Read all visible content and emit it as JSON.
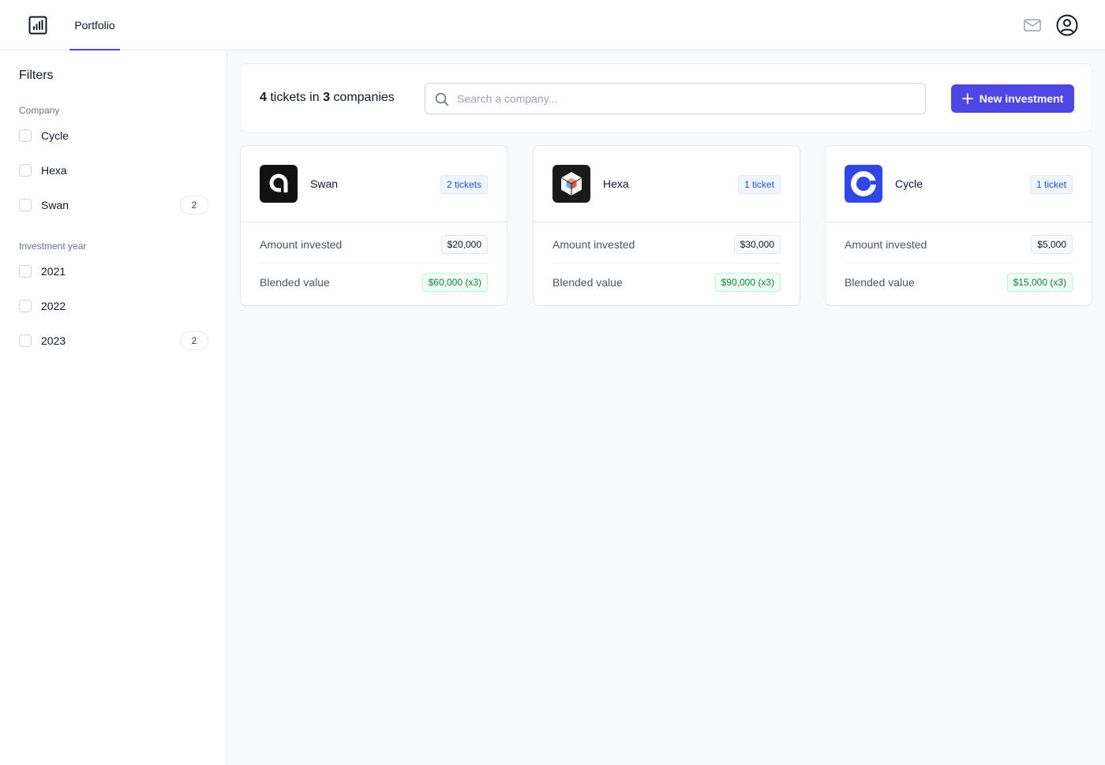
{
  "nav": {
    "logo_icon": "bar-chart-icon",
    "tabs": [
      {
        "label": "Portfolio",
        "active": true
      }
    ],
    "mail_icon": "mail-icon",
    "user_icon": "user-circle-icon",
    "accent_color": "#4f46e5"
  },
  "sidebar": {
    "title": "Filters",
    "groups": [
      {
        "label": "Company",
        "items": [
          {
            "label": "Cycle",
            "checked": false,
            "count": ""
          },
          {
            "label": "Hexa",
            "checked": false,
            "count": ""
          },
          {
            "label": "Swan",
            "checked": false,
            "count": "2"
          }
        ]
      },
      {
        "label": "Investment year",
        "items": [
          {
            "label": "2021",
            "checked": false,
            "count": ""
          },
          {
            "label": "2022",
            "checked": false,
            "count": ""
          },
          {
            "label": "2023",
            "checked": false,
            "count": "2"
          }
        ]
      }
    ]
  },
  "main": {
    "summary": {
      "ticket_count": "4",
      "tickets_word": "tickets in",
      "company_count": "3",
      "companies_word": "companies"
    },
    "search": {
      "placeholder": "Search a company...",
      "value": ""
    },
    "new_button_label": "New investment",
    "cards": [
      {
        "name": "Swan",
        "logo_icon": "swan-logo-icon",
        "logo_bg": "#111111",
        "tickets_label": "2 tickets",
        "amount_label": "Amount invested",
        "amount_value": "$20,000",
        "blended_label": "Blended value",
        "blended_value": "$60,000 (x3)"
      },
      {
        "name": "Hexa",
        "logo_icon": "hexa-logo-icon",
        "logo_bg": "#1a1a1a",
        "tickets_label": "1 ticket",
        "amount_label": "Amount invested",
        "amount_value": "$30,000",
        "blended_label": "Blended value",
        "blended_value": "$90,000 (x3)"
      },
      {
        "name": "Cycle",
        "logo_icon": "cycle-logo-icon",
        "logo_bg": "#2f46e8",
        "tickets_label": "1 ticket",
        "amount_label": "Amount invested",
        "amount_value": "$5,000",
        "blended_label": "Blended value",
        "blended_value": "$15,000 (x3)"
      }
    ]
  }
}
